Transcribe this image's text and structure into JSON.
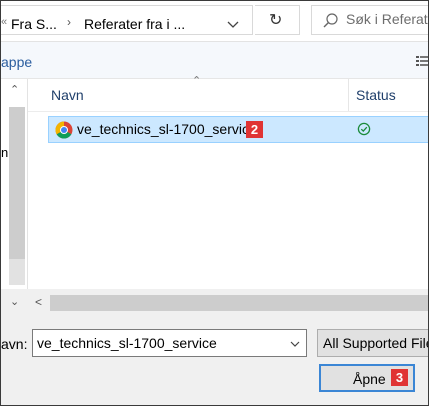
{
  "address_bar": {
    "breadcrumb": [
      "Fra S...",
      "Referater fra i ..."
    ],
    "search_placeholder": "Søk i Referater"
  },
  "toolbar": {
    "new_folder_label": "appe"
  },
  "nav_pane": {
    "partial_label": "n"
  },
  "columns": {
    "name": "Navn",
    "status": "Status"
  },
  "files": [
    {
      "name": "ve_technics_sl-1700_service",
      "status": "synced",
      "icon": "chrome-icon",
      "selected": true
    }
  ],
  "footer": {
    "filename_label": "avn:",
    "filename_value": "ve_technics_sl-1700_service",
    "filetype_value": "All Supported Files",
    "open_label": "Åpne"
  },
  "badges": {
    "file": "2",
    "open": "3"
  },
  "colors": {
    "selection": "#cce8ff",
    "selection_border": "#99d1ff",
    "badge": "#e03434",
    "accent": "#3b86d5",
    "status_ok": "#1a8a3a"
  }
}
